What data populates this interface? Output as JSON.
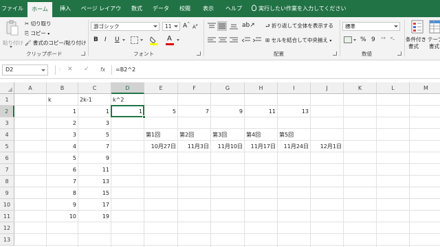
{
  "tabs": [
    {
      "label": "ファイル",
      "active": false
    },
    {
      "label": "ホーム",
      "active": true
    },
    {
      "label": "挿入",
      "active": false
    },
    {
      "label": "ページ レイアウト",
      "active": false
    },
    {
      "label": "数式",
      "active": false
    },
    {
      "label": "データ",
      "active": false
    },
    {
      "label": "校閲",
      "active": false
    },
    {
      "label": "表示",
      "active": false
    },
    {
      "label": "ヘルプ",
      "active": false
    }
  ],
  "tell_me": "実行したい作業を入力してください",
  "ribbon": {
    "clipboard": {
      "paste_label": "貼り付け",
      "cut_label": "切り取り",
      "copy_label": "コピー",
      "format_painter_label": "書式のコピー/貼り付け",
      "group_label": "クリップボード"
    },
    "font": {
      "font_name": "游ゴシック",
      "font_size": "11",
      "bold": "B",
      "italic": "I",
      "underline": "U",
      "font_color_glyph": "A",
      "grow_glyph": "A",
      "shrink_glyph": "A",
      "group_label": "フォント"
    },
    "alignment": {
      "wrap_label": "折り返して全体を表示する",
      "merge_label": "セルを結合して中央揃え",
      "group_label": "配置"
    },
    "number": {
      "format": "標準",
      "percent": "%",
      "comma": "9",
      "group_label": "数値"
    },
    "styles": {
      "conditional_label": "条件付き",
      "conditional_label2": "書式",
      "table_label": "テーブ",
      "table_label2": "書式"
    }
  },
  "formula_bar": {
    "name_box": "D2",
    "fx": "fx",
    "formula": "=B2^2"
  },
  "sheet": {
    "columns": [
      "A",
      "B",
      "C",
      "D",
      "E",
      "F",
      "G",
      "H",
      "I",
      "J",
      "K",
      "L",
      "M"
    ],
    "selected_column": "D",
    "rows": [
      "1",
      "2",
      "3",
      "4",
      "5",
      "6",
      "7",
      "8",
      "9",
      "10",
      "11",
      "12",
      "13"
    ],
    "selected_row": "2",
    "active_cell": "D2",
    "cells": [
      {
        "ref": "B1",
        "value": "k",
        "align": "txt"
      },
      {
        "ref": "C1",
        "value": "2k-1",
        "align": "txt"
      },
      {
        "ref": "D1",
        "value": "k^2",
        "align": "txt"
      },
      {
        "ref": "B2",
        "value": "1",
        "align": "num"
      },
      {
        "ref": "C2",
        "value": "1",
        "align": "num"
      },
      {
        "ref": "D2",
        "value": "1",
        "align": "num"
      },
      {
        "ref": "E2",
        "value": "5",
        "align": "num"
      },
      {
        "ref": "F2",
        "value": "7",
        "align": "num"
      },
      {
        "ref": "G2",
        "value": "9",
        "align": "num"
      },
      {
        "ref": "H2",
        "value": "11",
        "align": "num"
      },
      {
        "ref": "I2",
        "value": "13",
        "align": "num"
      },
      {
        "ref": "B3",
        "value": "2",
        "align": "num"
      },
      {
        "ref": "C3",
        "value": "3",
        "align": "num"
      },
      {
        "ref": "B4",
        "value": "3",
        "align": "num"
      },
      {
        "ref": "C4",
        "value": "5",
        "align": "num"
      },
      {
        "ref": "E4",
        "value": "第1回",
        "align": "txt"
      },
      {
        "ref": "F4",
        "value": "第2回",
        "align": "txt"
      },
      {
        "ref": "G4",
        "value": "第3回",
        "align": "txt"
      },
      {
        "ref": "H4",
        "value": "第4回",
        "align": "txt"
      },
      {
        "ref": "I4",
        "value": "第5回",
        "align": "txt"
      },
      {
        "ref": "B5",
        "value": "4",
        "align": "num"
      },
      {
        "ref": "C5",
        "value": "7",
        "align": "num"
      },
      {
        "ref": "E5",
        "value": "10月27日",
        "align": "num"
      },
      {
        "ref": "F5",
        "value": "11月3日",
        "align": "num"
      },
      {
        "ref": "G5",
        "value": "11月10日",
        "align": "num"
      },
      {
        "ref": "H5",
        "value": "11月17日",
        "align": "num"
      },
      {
        "ref": "I5",
        "value": "11月24日",
        "align": "num"
      },
      {
        "ref": "J5",
        "value": "12月1日",
        "align": "num"
      },
      {
        "ref": "B6",
        "value": "5",
        "align": "num"
      },
      {
        "ref": "C6",
        "value": "9",
        "align": "num"
      },
      {
        "ref": "B7",
        "value": "6",
        "align": "num"
      },
      {
        "ref": "C7",
        "value": "11",
        "align": "num"
      },
      {
        "ref": "B8",
        "value": "7",
        "align": "num"
      },
      {
        "ref": "C8",
        "value": "13",
        "align": "num"
      },
      {
        "ref": "B9",
        "value": "8",
        "align": "num"
      },
      {
        "ref": "C9",
        "value": "15",
        "align": "num"
      },
      {
        "ref": "B10",
        "value": "9",
        "align": "num"
      },
      {
        "ref": "C10",
        "value": "17",
        "align": "num"
      },
      {
        "ref": "B11",
        "value": "10",
        "align": "num"
      },
      {
        "ref": "C11",
        "value": "19",
        "align": "num"
      }
    ]
  },
  "colors": {
    "brand": "#217346",
    "ribbon_bg": "#f3f3f3",
    "font_color_swatch": "#e00000",
    "highlight_swatch": "#ffff00"
  }
}
